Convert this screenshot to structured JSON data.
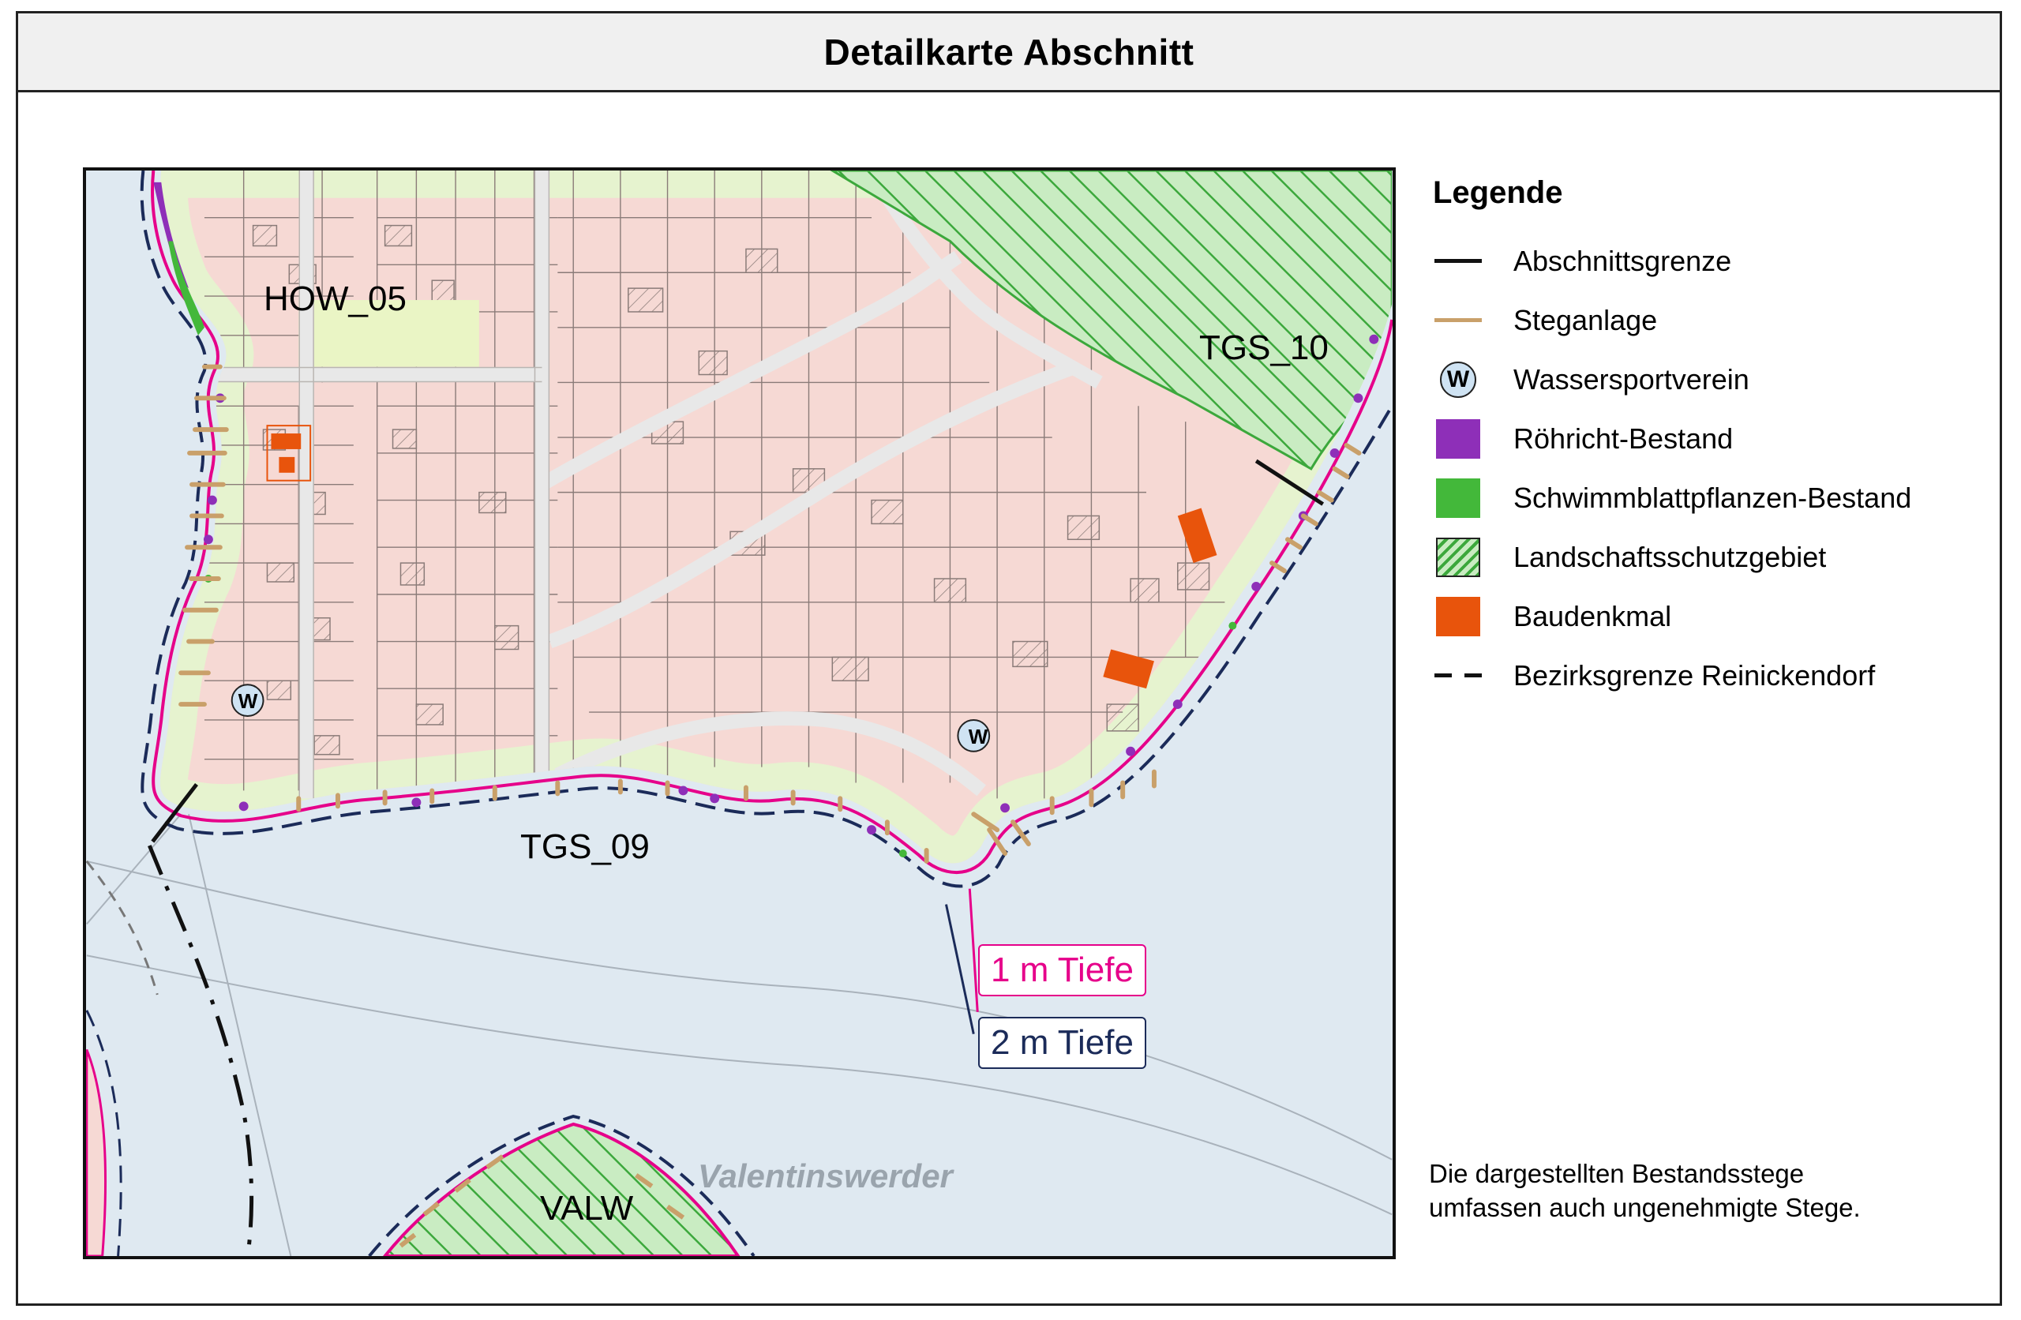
{
  "title": "Detailkarte Abschnitt",
  "map": {
    "section_labels": [
      "HOW_05",
      "TGS_10",
      "TGS_09",
      "VALW"
    ],
    "island_name": "Valentinswerder",
    "depth_labels": {
      "one_m": "1 m Tiefe",
      "two_m": "2 m Tiefe"
    },
    "club_marker": "W",
    "colors": {
      "water": "#dfe9f1",
      "land": "#f6d9d4",
      "green_strip": "#e6f3cf",
      "protected_area": "#3ca83c",
      "depth_1m": "#e6008a",
      "depth_2m": "#1b2b59",
      "jetty": "#c9a06a",
      "reed": "#8e2fb8",
      "floating_plants": "#43b83a",
      "monument": "#e8540c"
    }
  },
  "legend": {
    "title": "Legende",
    "items": [
      {
        "label": "Abschnittsgrenze",
        "symbol": "black-line"
      },
      {
        "label": "Steganlage",
        "symbol": "tan-line"
      },
      {
        "label": "Wassersportverein",
        "symbol": "w-circle"
      },
      {
        "label": "Röhricht-Bestand",
        "symbol": "purple-box",
        "color": "#8e2fb8"
      },
      {
        "label": "Schwimmblattpflanzen-Bestand",
        "symbol": "green-box",
        "color": "#43b83a"
      },
      {
        "label": "Landschaftsschutzgebiet",
        "symbol": "hatched-box",
        "color": "#3ca83c"
      },
      {
        "label": "Baudenkmal",
        "symbol": "orange-box",
        "color": "#e8540c"
      },
      {
        "label": "Bezirksgrenze Reinickendorf",
        "symbol": "dashed-line"
      }
    ]
  },
  "note": {
    "line1": "Die dargestellten Bestandsstege",
    "line2": "umfassen auch ungenehmigte Stege."
  }
}
